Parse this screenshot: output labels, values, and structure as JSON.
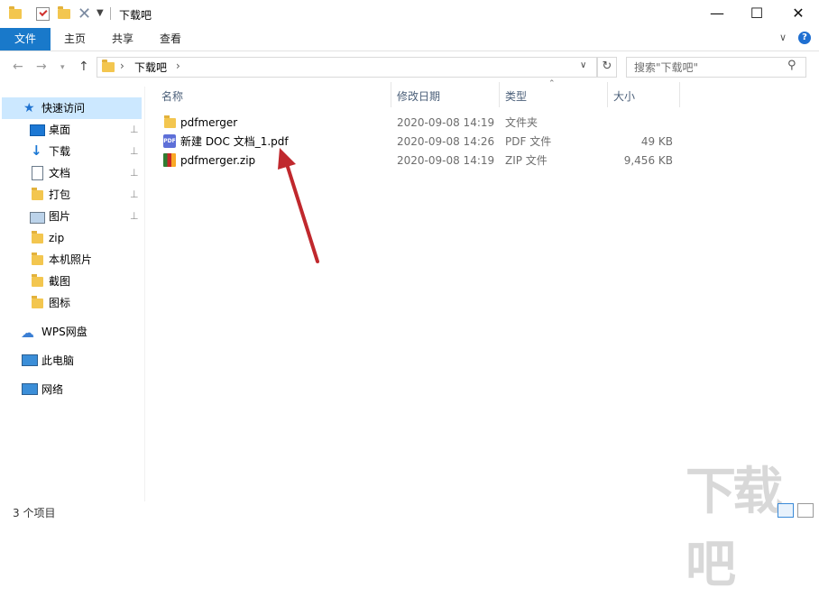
{
  "window": {
    "title": "下载吧",
    "controls": {
      "minimize": "—",
      "maximize": "☐",
      "close": "✕"
    }
  },
  "ribbon": {
    "tabs": [
      {
        "label": "文件",
        "active": true
      },
      {
        "label": "主页"
      },
      {
        "label": "共享"
      },
      {
        "label": "查看"
      }
    ],
    "help": "?"
  },
  "address": {
    "sep": "›",
    "crumb": "下载吧",
    "sep2": "›",
    "refresh": "↻",
    "search_placeholder": "搜索\"下载吧\""
  },
  "nav": {
    "quick_access": "快速访问",
    "items": [
      {
        "label": "桌面",
        "icon": "desktop-icon",
        "pinned": true
      },
      {
        "label": "下载",
        "icon": "download-icon",
        "pinned": true
      },
      {
        "label": "文档",
        "icon": "document-icon",
        "pinned": true
      },
      {
        "label": "打包",
        "icon": "folder-icon",
        "pinned": true
      },
      {
        "label": "图片",
        "icon": "pictures-icon",
        "pinned": true
      },
      {
        "label": "zip",
        "icon": "folder-icon"
      },
      {
        "label": "本机照片",
        "icon": "folder-icon"
      },
      {
        "label": "截图",
        "icon": "folder-icon"
      },
      {
        "label": "图标",
        "icon": "folder-icon"
      }
    ],
    "wps": "WPS网盘",
    "this_pc": "此电脑",
    "network": "网络",
    "pin_glyph": "📌"
  },
  "columns": {
    "name": "名称",
    "date": "修改日期",
    "type": "类型",
    "size": "大小"
  },
  "files": [
    {
      "name": "pdfmerger",
      "date": "2020-09-08 14:19",
      "type": "文件夹",
      "size": "",
      "icon": "folder-icon"
    },
    {
      "name": "新建 DOC 文档_1.pdf",
      "date": "2020-09-08 14:26",
      "type": "PDF 文件",
      "size": "49 KB",
      "icon": "pdf-icon"
    },
    {
      "name": "pdfmerger.zip",
      "date": "2020-09-08 14:19",
      "type": "ZIP 文件",
      "size": "9,456 KB",
      "icon": "zip-icon"
    }
  ],
  "status": {
    "count": "3 个项目"
  },
  "colors": {
    "accent": "#1979ca",
    "selection": "#cce8ff",
    "arrow": "#c0282d"
  },
  "watermark": "下载吧"
}
